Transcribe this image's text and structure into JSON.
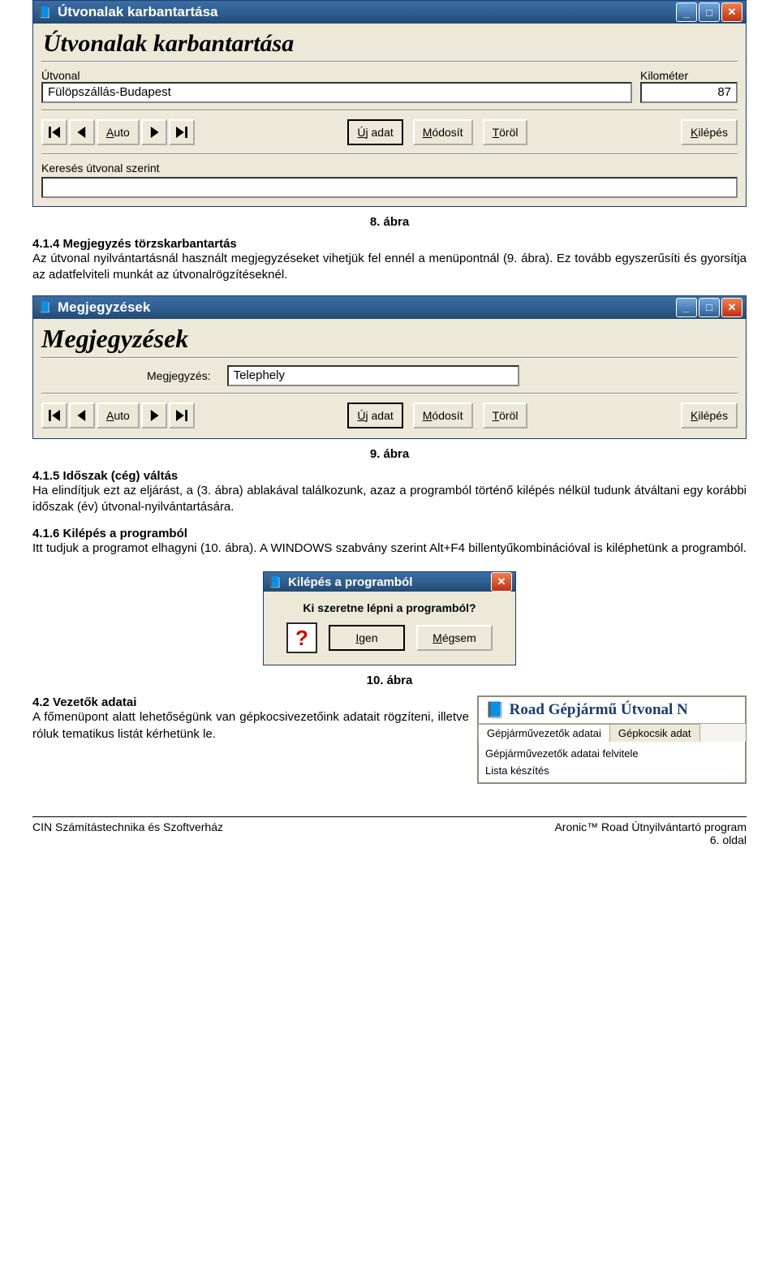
{
  "win1": {
    "titlebar": "Útvonalak karbantartása",
    "heading": "Útvonalak karbantartása",
    "utvonal_label": "Útvonal",
    "utvonal_value": "Fülöpszállás-Budapest",
    "km_label": "Kilométer",
    "km_value": "87",
    "auto_btn": "Auto",
    "ujadat_btn": "Új adat",
    "modosit_btn": "Módosít",
    "torol_btn": "Töröl",
    "kilepes_btn": "Kilépés",
    "kereses_label": "Keresés útvonal szerint"
  },
  "fig8_caption": "8. ábra",
  "sec414_title": "4.1.4 Megjegyzés törzskarbantartás",
  "sec414_body": "Az útvonal nyilvántartásnál használt megjegyzéseket vihetjük fel ennél a menüpontnál (9. ábra). Ez tovább egyszerűsíti és gyorsítja az adatfelviteli munkát az útvonalrögzítéseknél.",
  "win2": {
    "titlebar": "Megjegyzések",
    "heading": "Megjegyzések",
    "megj_label": "Megjegyzés:",
    "megj_value": "Telephely",
    "auto_btn": "Auto",
    "ujadat_btn": "Új adat",
    "modosit_btn": "Módosít",
    "torol_btn": "Töröl",
    "kilepes_btn": "Kilépés"
  },
  "fig9_caption": "9. ábra",
  "sec415_title": "4.1.5 Időszak (cég) váltás",
  "sec415_body": "Ha elindítjuk ezt az eljárást, a (3. ábra) ablakával találkozunk, azaz a programból történő kilépés nélkül tudunk átváltani egy korábbi időszak (év) útvonal-nyilvántartására.",
  "sec416_title": "4.1.6 Kilépés a programból",
  "sec416_body": "Itt tudjuk a programot elhagyni (10. ábra). A WINDOWS szabvány szerint Alt+F4 billentyűkombinációval is kiléphetünk a programból.",
  "dlg": {
    "titlebar": "Kilépés a programból",
    "question": "Ki szeretne lépni a programból?",
    "igen": "Igen",
    "megsem": "Mégsem"
  },
  "fig10_caption": "10. ábra",
  "sec42_title": "4.2 Vezetők adatai",
  "sec42_body": "A főmenüpont alatt lehetőségünk van gépkocsivezetőink adatait rögzíteni, illetve róluk tematikus listát kérhetünk le.",
  "rightapp": {
    "title": "Road Gépjármű Útvonal N",
    "tab1": "Gépjárművezetők adatai",
    "tab2": "Gépkocsik adat",
    "menu1": "Gépjárművezetők adatai felvitele",
    "menu2": "Lista készítés"
  },
  "footer": {
    "left": "CIN Számítástechnika és Szoftverház",
    "right1": "Aronic™ Road Útnyilvántartó program",
    "right2": "6. oldal"
  },
  "ul_letters": {
    "A": "A",
    "U": "Ú",
    "M": "M",
    "T": "T",
    "K": "K",
    "I": "I"
  }
}
